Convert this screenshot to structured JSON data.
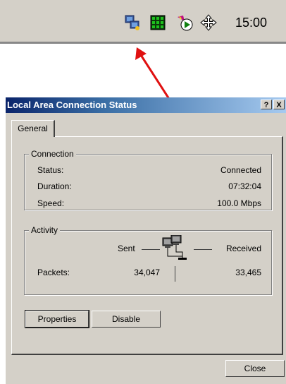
{
  "tray": {
    "icons": [
      "network-connection-icon",
      "green-grid-icon",
      "media-player-icon",
      "move-arrows-icon"
    ],
    "clock": "15:00"
  },
  "annotation": {
    "arrow_color": "#e01010"
  },
  "dialog": {
    "title": "Local Area Connection Status",
    "help_button": "?",
    "close_button": "X",
    "tab": "General",
    "connection": {
      "legend": "Connection",
      "status_label": "Status:",
      "status_value": "Connected",
      "duration_label": "Duration:",
      "duration_value": "07:32:04",
      "speed_label": "Speed:",
      "speed_value": "100.0 Mbps"
    },
    "activity": {
      "legend": "Activity",
      "sent_label": "Sent",
      "received_label": "Received",
      "packets_label": "Packets:",
      "packets_sent": "34,047",
      "packets_received": "33,465"
    },
    "buttons": {
      "properties": "Properties",
      "disable": "Disable",
      "close": "Close"
    }
  }
}
